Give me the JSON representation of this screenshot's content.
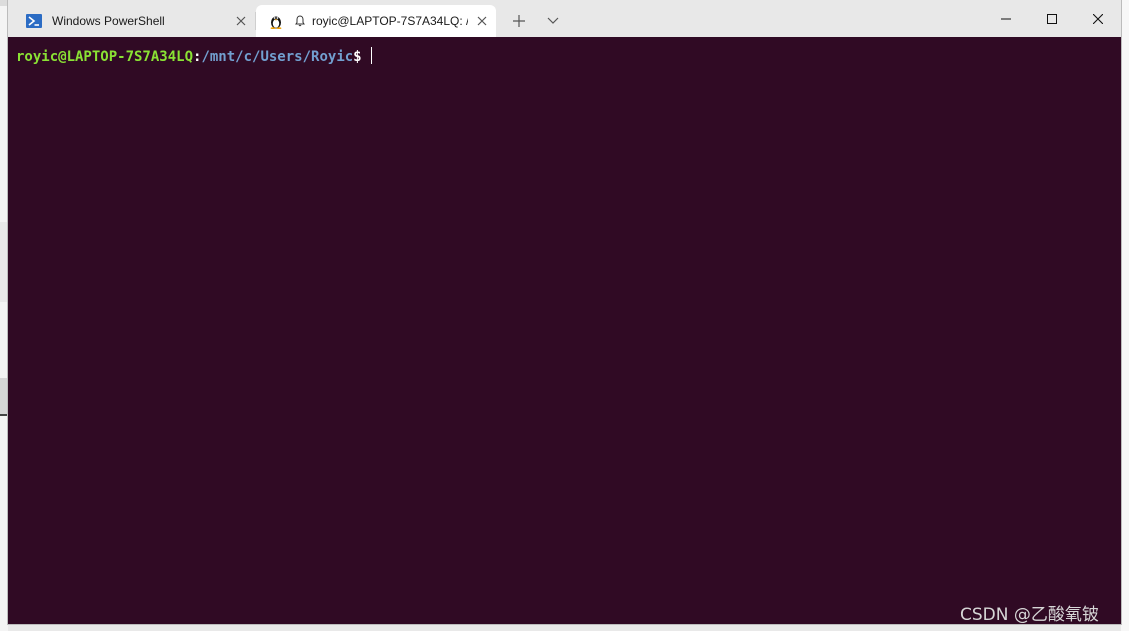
{
  "tabs": [
    {
      "title": "Windows PowerShell",
      "icon": "powershell-icon",
      "active": false
    },
    {
      "title": "royic@LAPTOP-7S7A34LQ: /",
      "icon": "linux-penguin-icon",
      "active": true
    }
  ],
  "tab_actions": {
    "new_tab_icon": "plus-icon",
    "dropdown_icon": "chevron-down-icon"
  },
  "window_controls": {
    "minimize": "minimize-icon",
    "maximize": "maximize-icon",
    "close": "close-icon"
  },
  "terminal": {
    "user_host": "royic@LAPTOP-7S7A34LQ",
    "separator": ":",
    "path": "/mnt/c/Users/Royic",
    "prompt_symbol": "$",
    "background": "#300a24",
    "user_color": "#8ae234",
    "path_color": "#729fcf"
  },
  "watermark": "CSDN @乙酸氧铍"
}
